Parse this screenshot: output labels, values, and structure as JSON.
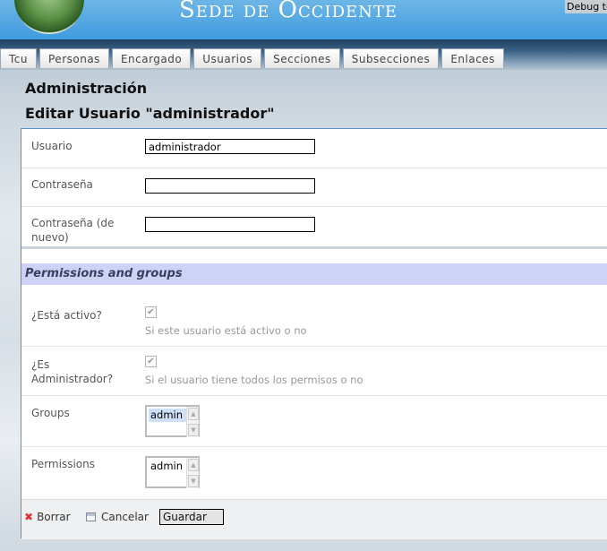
{
  "header": {
    "site_title": "Sede de Occidente",
    "debug_label": "Debug toolbar"
  },
  "nav": {
    "tabs": [
      {
        "label": "Tcu"
      },
      {
        "label": "Personas"
      },
      {
        "label": "Encargado"
      },
      {
        "label": "Usuarios"
      },
      {
        "label": "Secciones"
      },
      {
        "label": "Subsecciones"
      },
      {
        "label": "Enlaces"
      }
    ]
  },
  "page": {
    "title": "Administración",
    "subtitle": "Editar Usuario \"administrador\""
  },
  "form": {
    "usuario_label": "Usuario",
    "usuario_value": "administrador",
    "password_label": "Contraseña",
    "password_value": "",
    "password2_label": "Contraseña (de nuevo)",
    "password2_value": "",
    "section_title": "Permissions and groups",
    "activo_label": "¿Está activo?",
    "activo_checked": true,
    "activo_help": "Si este usuario está activo o no",
    "admin_label": "¿Es Administrador?",
    "admin_checked": true,
    "admin_help": "Si el usuario tiene todos los permisos o no",
    "groups_label": "Groups",
    "groups_options": [
      "admin"
    ],
    "groups_selected": "admin",
    "permissions_label": "Permissions",
    "permissions_options": [
      "admin"
    ]
  },
  "footer": {
    "delete_label": "Borrar",
    "cancel_label": "Cancelar",
    "save_label": "Guardar"
  },
  "icons": {
    "delete": "x-icon",
    "cancel": "calendar-icon"
  },
  "colors": {
    "banner": "#3f9be0",
    "section_bg": "#cdd2f6",
    "panel_border": "#5a93c8",
    "delete_icon": "#dd3333"
  }
}
